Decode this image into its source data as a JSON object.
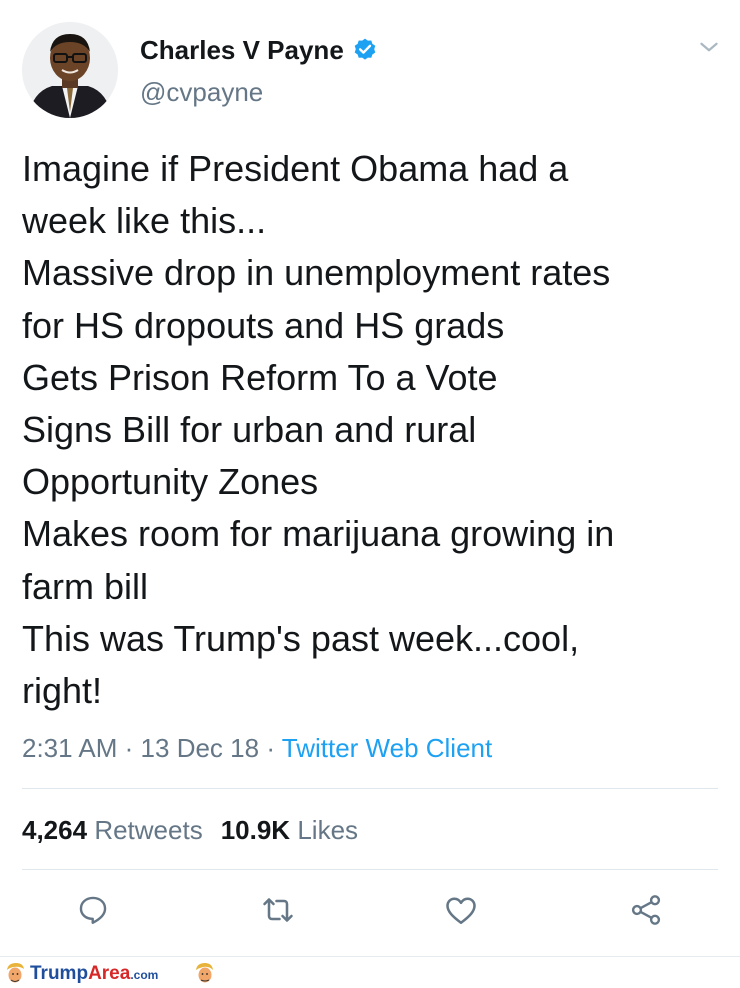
{
  "tweet": {
    "display_name": "Charles V Payne",
    "handle": "@cvpayne",
    "lines": [
      "Imagine if President Obama had a",
      "week like this...",
      "Massive drop in unemployment rates",
      "for HS dropouts and HS grads",
      "Gets Prison Reform To a Vote",
      "Signs Bill for urban and rural",
      "Opportunity Zones",
      "Makes room for marijuana growing in",
      "farm bill",
      "This was Trump's past week...cool,",
      "right!"
    ],
    "time": "2:31 AM",
    "separator": "·",
    "date": "13 Dec 18",
    "client": "Twitter Web Client"
  },
  "stats": {
    "retweets_count": "4,264",
    "retweets_label": "Retweets",
    "likes_count": "10.9K",
    "likes_label": "Likes"
  },
  "icons": {
    "verified": "verified-badge-icon",
    "caret": "chevron-down-icon",
    "reply": "reply-icon",
    "retweet": "retweet-icon",
    "like": "heart-icon",
    "share": "share-icon"
  },
  "footer": {
    "brand_part1": "Trump",
    "brand_part2": "Area",
    "brand_part3": ".com"
  },
  "colors": {
    "accent": "#1da1f2",
    "secondary_text": "#657786",
    "primary_text": "#14171a"
  }
}
